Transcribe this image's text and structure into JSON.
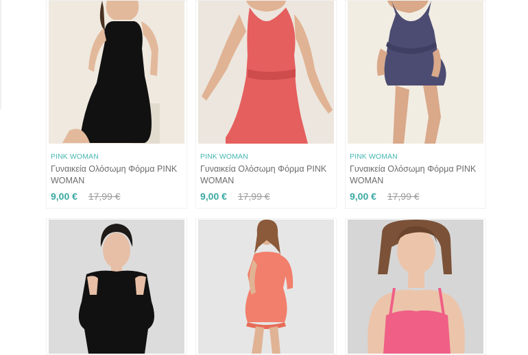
{
  "products_row1": [
    {
      "brand": "PINK WOMAN",
      "name": "Γυναικεία Ολόσωμη Φόρμα PINK WOMAN",
      "sale_price": "9,00 €",
      "old_price": "17,99 €",
      "image": "black-romper-photo"
    },
    {
      "brand": "PINK WOMAN",
      "name": "Γυναικεία Ολόσωμη Φόρμα PINK WOMAN",
      "sale_price": "9,00 €",
      "old_price": "17,99 €",
      "image": "coral-romper-photo"
    },
    {
      "brand": "PINK WOMAN",
      "name": "Γυναικεία Ολόσωμη Φόρμα PINK WOMAN",
      "sale_price": "9,00 €",
      "old_price": "17,99 €",
      "image": "navy-romper-photo"
    }
  ],
  "products_row2": [
    {
      "image": "black-cold-shoulder-top-photo"
    },
    {
      "image": "coral-ruffle-romper-photo"
    },
    {
      "image": "pink-camisole-photo"
    }
  ],
  "colors": {
    "brand_accent": "#45b6b0",
    "price_accent": "#3aa9a3",
    "old_price": "#9a9a9a"
  }
}
